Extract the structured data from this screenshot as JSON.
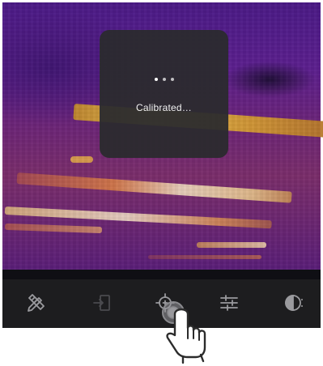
{
  "camera_view": {
    "label": "thermal-camera-view"
  },
  "toast": {
    "dots": "•••",
    "message": "Calibrated…"
  },
  "toolbar": {
    "items": [
      {
        "icon": "tools-icon",
        "label": ""
      },
      {
        "icon": "import-icon",
        "label": ""
      },
      {
        "icon": "calibrate-target-icon",
        "label": ""
      },
      {
        "icon": "sliders-icon",
        "label": ""
      },
      {
        "icon": "palette-icon",
        "label": ""
      }
    ]
  },
  "colors": {
    "toolbar_bg": "#1d1d1f",
    "icon_color": "#9a9a9e",
    "icon_dim": "#4a4a4e",
    "toast_bg": "#2a2a2e",
    "toast_text": "#f2f2f2"
  }
}
